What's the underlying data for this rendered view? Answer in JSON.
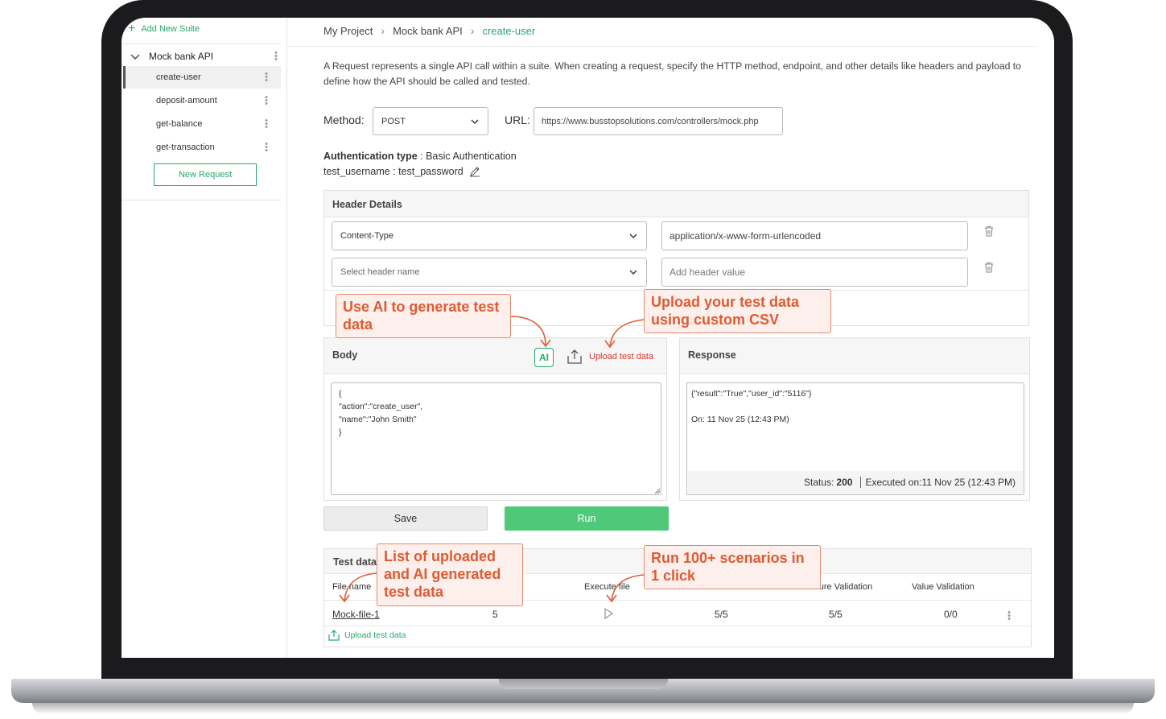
{
  "sidebar": {
    "add_suite": "Add New Suite",
    "suite_name": "Mock bank API",
    "requests": [
      "create-user",
      "deposit-amount",
      "get-balance",
      "get-transaction"
    ],
    "new_request": "New Request"
  },
  "breadcrumb": {
    "items": [
      "My Project",
      "Mock bank API",
      "create-user"
    ]
  },
  "description": "A Request represents a single API call within a suite. When creating a request, specify the HTTP method, endpoint, and other details like headers and payload to define how the API should be called and tested.",
  "request": {
    "method_label": "Method:",
    "method_value": "POST",
    "url_label": "URL:",
    "url_value": "https://www.busstopsolutions.com/controllers/mock.php"
  },
  "auth": {
    "type_label": "Authentication type",
    "type_value": " : Basic Authentication",
    "credentials": "test_username : test_password"
  },
  "headers": {
    "title": "Header Details",
    "rows": [
      {
        "name": "Content-Type",
        "value": "application/x-www-form-urlencoded"
      },
      {
        "name_placeholder": "Select header name",
        "value_placeholder": "Add header value"
      }
    ]
  },
  "body": {
    "title": "Body",
    "ai_label": "AI",
    "upload_label": "Upload test data",
    "content": "{\n\"action\":\"create_user\",\n\"name\":\"John Smith\"\n}"
  },
  "response": {
    "title": "Response",
    "content": "{\"result\":\"True\",\"user_id\":\"5116\"}",
    "on": "On: 11 Nov 25 (12:43 PM)",
    "status_label": "Status:",
    "status_code": "200",
    "executed": "Executed on:11 Nov 25 (12:43 PM)"
  },
  "actions": {
    "save": "Save",
    "run": "Run"
  },
  "test_data": {
    "title": "Test data",
    "columns": [
      "File name",
      "Execute file",
      "Structure Validation",
      "Value Validation"
    ],
    "rows": [
      {
        "file": "Mock-file-1",
        "count": "5",
        "status": "5/5",
        "structure": "5/5",
        "value": "0/0"
      }
    ],
    "upload_label": "Upload test data"
  },
  "callouts": {
    "ai": "Use AI to generate test data",
    "csv": "Upload your test data using custom CSV",
    "list": "List of uploaded and AI generated test data",
    "run": "Run 100+ scenarios in 1 click"
  },
  "colors": {
    "accent": "#27a96b",
    "run_button": "#4fc87a",
    "callout_text": "#e05a32",
    "upload_red": "#e03030"
  }
}
